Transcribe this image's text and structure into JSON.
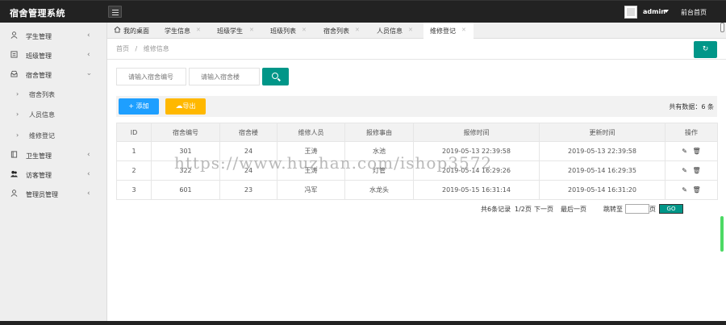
{
  "app": {
    "title": "宿舍管理系统"
  },
  "header": {
    "user": "admin",
    "front_link": "前台首页"
  },
  "sidebar": {
    "items": [
      {
        "label": "学生管理",
        "icon": "user-icon"
      },
      {
        "label": "班级管理",
        "icon": "calendar-icon"
      },
      {
        "label": "宿舍管理",
        "icon": "inbox-icon",
        "expanded": true,
        "children": [
          {
            "label": "宿舍列表"
          },
          {
            "label": "人员信息"
          },
          {
            "label": "维修登记"
          }
        ]
      },
      {
        "label": "卫生管理",
        "icon": "book-icon"
      },
      {
        "label": "访客管理",
        "icon": "users-icon"
      },
      {
        "label": "管理员管理",
        "icon": "user-icon"
      }
    ]
  },
  "tabs": [
    {
      "label": "我的桌面",
      "closable": false,
      "icon": "home-icon"
    },
    {
      "label": "学生信息",
      "closable": true
    },
    {
      "label": "班级学生",
      "closable": true
    },
    {
      "label": "班级列表",
      "closable": true
    },
    {
      "label": "宿舍列表",
      "closable": true
    },
    {
      "label": "人员信息",
      "closable": true
    },
    {
      "label": "维修登记",
      "closable": true,
      "active": true
    }
  ],
  "breadcrumb": {
    "home": "首页",
    "separator": "/",
    "current": "维修信息"
  },
  "search": {
    "dorm_number_placeholder": "请输入宿舍编号",
    "building_placeholder": "请输入宿舍楼"
  },
  "toolbar": {
    "add_label": "+ 添加",
    "export_label": "导出",
    "total_text": "共有数据：6 条"
  },
  "table": {
    "headers": [
      "ID",
      "宿舍编号",
      "宿舍楼",
      "维修人员",
      "报修事由",
      "报修时间",
      "更新时间",
      "操作"
    ],
    "rows": [
      [
        "1",
        "301",
        "24",
        "王涛",
        "水池",
        "2019-05-13 22:39:58",
        "2019-05-13 22:39:58"
      ],
      [
        "2",
        "322",
        "24",
        "王涛",
        "灯管",
        "2019-05-14 16:29:26",
        "2019-05-14 16:29:35"
      ],
      [
        "3",
        "601",
        "23",
        "冯军",
        "水龙头",
        "2019-05-15 16:31:14",
        "2019-05-14 16:31:20"
      ]
    ]
  },
  "pager": {
    "summary": "共6条记录",
    "page": "1/2页",
    "next": "下一页",
    "last": "最后一页",
    "jump_to": "跳转至",
    "page_unit": "页",
    "go": "GO"
  },
  "watermark": "https://www.huzhan.com/ishop3572",
  "colors": {
    "topbar": "#222222",
    "primary_green": "#009688",
    "add_blue": "#1e9fff",
    "export_yellow": "#ffb800"
  }
}
